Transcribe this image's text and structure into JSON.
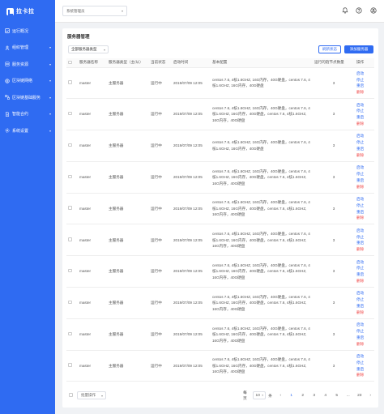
{
  "app": {
    "name": "拉卡拉"
  },
  "sidebar": {
    "items": [
      {
        "label": "运行概况",
        "icon": "dashboard-icon",
        "has_children": false
      },
      {
        "label": "组织管理",
        "icon": "org-icon",
        "has_children": true
      },
      {
        "label": "服务资源",
        "icon": "server-icon",
        "has_children": true
      },
      {
        "label": "区块链网络",
        "icon": "network-icon",
        "has_children": true
      },
      {
        "label": "区块链基础服务",
        "icon": "blockchain-icon",
        "has_children": true
      },
      {
        "label": "智能合约",
        "icon": "contract-icon",
        "has_children": true
      },
      {
        "label": "系统设置",
        "icon": "settings-icon",
        "has_children": true
      }
    ]
  },
  "header": {
    "system_select": "系统管理员"
  },
  "panel": {
    "title": "服务器管理",
    "type_filter": "全部服务器类型",
    "refresh_label": "刷新状态",
    "add_label": "添加服务器"
  },
  "table": {
    "columns": [
      "服务器名称",
      "服务器类型（主/从）",
      "当前状态",
      "启动时间",
      "基本配置",
      "运行的链节点数量",
      "操作"
    ],
    "ops": {
      "start": "启动",
      "stop": "停止",
      "restart": "重启",
      "delete": "删除"
    },
    "rows": [
      {
        "name": "master",
        "type": "主服务器",
        "status": "运行中",
        "start_time": "2019/07/09 12:05",
        "config": "centos 7.6, 4核1.6GHZ, 16G内存，40G硬盘，centos 7.6, 4核1.6GHZ, 16G内存，40G硬盘",
        "nodes": "3"
      },
      {
        "name": "master",
        "type": "主服务器",
        "status": "运行中",
        "start_time": "2019/07/09 12:05",
        "config": "centos 7.6, 4核1.6GHZ, 16G内存，40G硬盘，centos 7.6, 4核1.6GHZ, 16G内存，40G硬盘，centos 7.6, 4核1.6GHZ, 16G内存，40G硬盘",
        "nodes": "3"
      },
      {
        "name": "master",
        "type": "主服务器",
        "status": "运行中",
        "start_time": "2019/07/09 12:05",
        "config": "centos 7.6, 4核1.6GHZ, 16G内存，40G硬盘，centos 7.6, 4核1.6GHZ, 16G内存，40G硬盘",
        "nodes": "3"
      },
      {
        "name": "master",
        "type": "主服务器",
        "status": "运行中",
        "start_time": "2019/07/09 12:05",
        "config": "centos 7.6, 4核1.6GHZ, 16G内存，40G硬盘，centos 7.6, 4核1.6GHZ, 16G内存，40G硬盘，centos 7.6, 4核1.6GHZ, 16G内存，40G硬盘",
        "nodes": "3"
      },
      {
        "name": "master",
        "type": "主服务器",
        "status": "运行中",
        "start_time": "2019/07/09 12:05",
        "config": "centos 7.6, 4核1.6GHZ, 16G内存，40G硬盘，centos 7.6, 4核1.6GHZ, 16G内存，40G硬盘，centos 7.6, 4核1.6GHZ, 16G内存，40G硬盘",
        "nodes": "3"
      },
      {
        "name": "master",
        "type": "主服务器",
        "status": "运行中",
        "start_time": "2019/07/09 12:05",
        "config": "centos 7.6, 4核1.6GHZ, 16G内存，40G硬盘，centos 7.6, 4核1.6GHZ, 16G内存，40G硬盘，centos 7.6, 4核1.6GHZ, 16G内存，40G硬盘",
        "nodes": "3"
      },
      {
        "name": "master",
        "type": "主服务器",
        "status": "运行中",
        "start_time": "2019/07/09 12:05",
        "config": "centos 7.6, 4核1.6GHZ, 16G内存，40G硬盘，centos 7.6, 4核1.6GHZ, 16G内存，40G硬盘，centos 7.6, 4核1.6GHZ, 16G内存，40G硬盘",
        "nodes": "3"
      },
      {
        "name": "master",
        "type": "主服务器",
        "status": "运行中",
        "start_time": "2019/07/09 12:05",
        "config": "centos 7.6, 4核1.6GHZ, 16G内存，40G硬盘，centos 7.6, 4核1.6GHZ, 16G内存，40G硬盘，centos 7.6, 4核1.6GHZ, 16G内存，40G硬盘",
        "nodes": "3"
      },
      {
        "name": "master",
        "type": "主服务器",
        "status": "运行中",
        "start_time": "2019/07/09 12:05",
        "config": "centos 7.6, 4核1.6GHZ, 16G内存，40G硬盘，centos 7.6, 4核1.6GHZ, 16G内存，40G硬盘，centos 7.6, 4核1.6GHZ, 16G内存，40G硬盘",
        "nodes": "3"
      },
      {
        "name": "master",
        "type": "主服务器",
        "status": "运行中",
        "start_time": "2019/07/09 12:05",
        "config": "centos 7.6, 4核1.6GHZ, 16G内存，40G硬盘，centos 7.6, 4核1.6GHZ, 16G内存，40G硬盘，centos 7.6, 4核1.6GHZ, 16G内存，40G硬盘",
        "nodes": "3"
      }
    ]
  },
  "footer": {
    "batch_label": "批量操作",
    "page_size_prefix": "每页",
    "page_size": "10",
    "page_size_suffix": "条",
    "prev": "‹",
    "pages": [
      "1",
      "2",
      "3",
      "4",
      "5",
      "...",
      "23"
    ],
    "next": "›"
  },
  "colors": {
    "brand": "#2f6bf2",
    "danger": "#f04848"
  }
}
